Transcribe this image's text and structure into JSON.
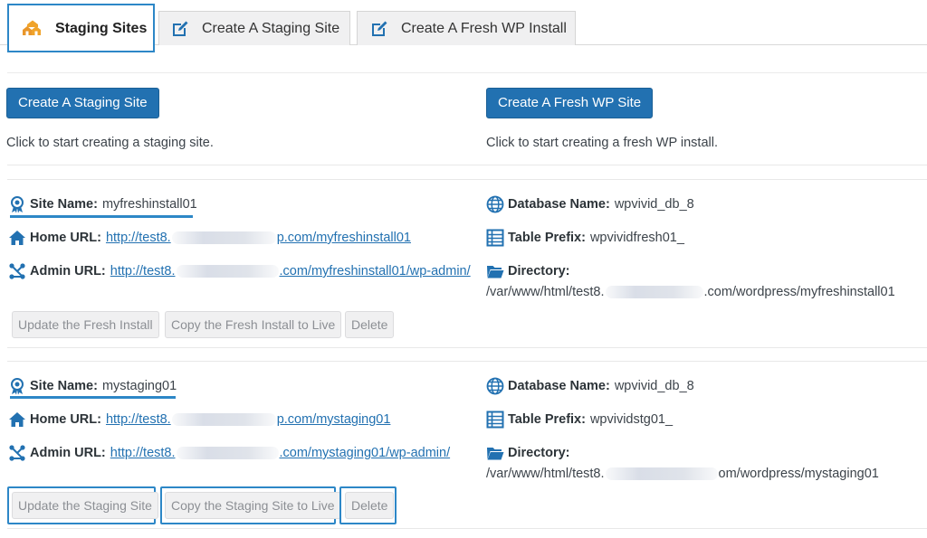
{
  "tabs": [
    {
      "label": "Staging Sites",
      "icon": "home-icon",
      "active": true
    },
    {
      "label": "Create A Staging Site",
      "icon": "edit-icon",
      "active": false
    },
    {
      "label": "Create A Fresh WP Install",
      "icon": "edit-icon",
      "active": false
    }
  ],
  "create": {
    "staging_button": "Create A Staging Site",
    "staging_hint": "Click to start creating a staging site.",
    "fresh_button": "Create A Fresh WP Site",
    "fresh_hint": "Click to start creating a fresh WP install."
  },
  "labels": {
    "site_name": "Site Name:",
    "home_url": "Home URL:",
    "admin_url": "Admin URL:",
    "db_name": "Database Name:",
    "table_prefix": "Table Prefix:",
    "directory": "Directory:"
  },
  "sites": [
    {
      "site_name": "myfreshinstall01",
      "home_url_start": "http://test8.",
      "home_url_end": "p.com/myfreshinstall01",
      "admin_url_start": "http://test8.",
      "admin_url_end": ".com/myfreshinstall01/wp-admin/",
      "db_name": "wpvivid_db_8",
      "table_prefix": "wpvividfresh01_",
      "directory_start": "/var/www/html/test8.",
      "directory_end": ".com/wordpress/myfreshinstall01",
      "buttons": [
        "Update the Fresh Install",
        "Copy the Fresh Install to Live",
        "Delete"
      ]
    },
    {
      "site_name": "mystaging01",
      "home_url_start": "http://test8.",
      "home_url_end": "p.com/mystaging01",
      "admin_url_start": "http://test8.",
      "admin_url_end": ".com/mystaging01/wp-admin/",
      "db_name": "wpvivid_db_8",
      "table_prefix": "wpvividstg01_",
      "directory_start": "/var/www/html/test8.",
      "directory_end": "om/wordpress/mystaging01",
      "buttons": [
        "Update the Staging Site",
        "Copy the Staging Site to Live",
        "Delete"
      ]
    }
  ],
  "colors": {
    "accent": "#2d87c7",
    "button_blue": "#2271b1",
    "link": "#2271b1"
  }
}
